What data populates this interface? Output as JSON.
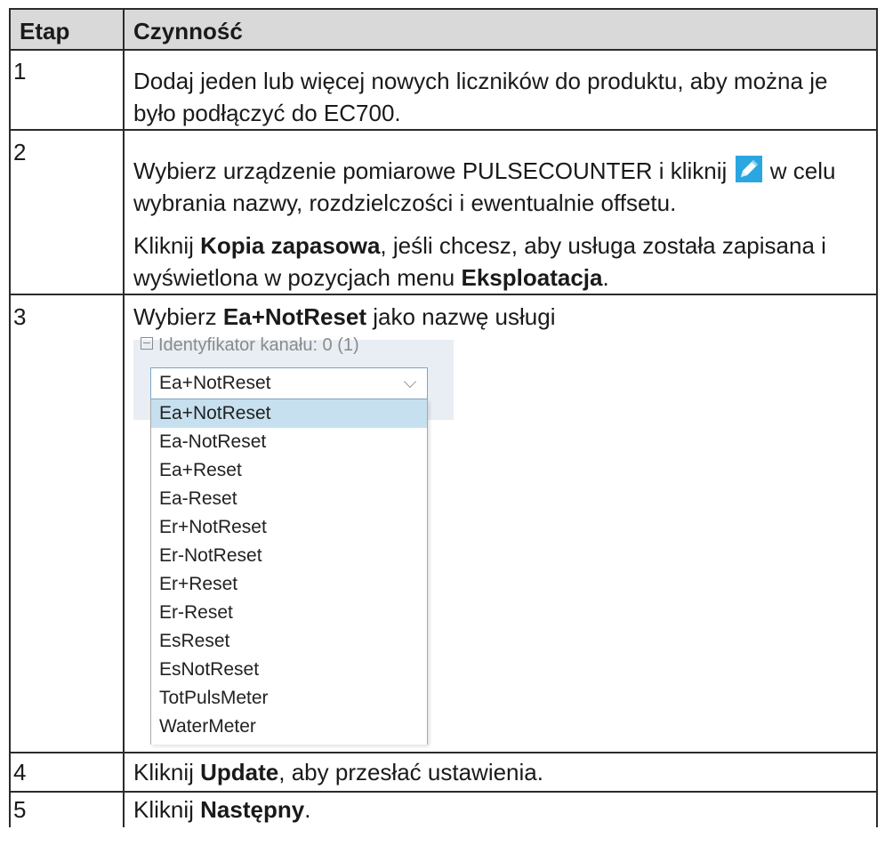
{
  "table": {
    "header": {
      "step": "Etap",
      "action": "Czynność"
    },
    "rows": [
      {
        "step": "1",
        "text": "Dodaj jeden lub więcej nowych liczników do produktu, aby można je było podłączyć do EC700."
      },
      {
        "step": "2",
        "p1_before_icon": "Wybierz urządzenie pomiarowe PULSECOUNTER i kliknij ",
        "p1_after_icon": " w celu wybrania nazwy, rozdzielczości i ewentualnie offsetu.",
        "p2_pre": "Kliknij ",
        "p2_bold1": "Kopia zapasowa",
        "p2_mid": ", jeśli chcesz, aby usługa została zapisana i wyświetlona w pozycjach menu ",
        "p2_bold2": "Eksploatacja",
        "p2_post": "."
      },
      {
        "step": "3",
        "pre": "Wybierz ",
        "bold": "Ea+NotReset",
        "post": " jako nazwę usługi"
      },
      {
        "step": "4",
        "pre": "Kliknij ",
        "bold": "Update",
        "post": ", aby przesłać ustawienia."
      },
      {
        "step": "5",
        "pre": "Kliknij ",
        "bold": "Następny",
        "post": "."
      }
    ]
  },
  "dropdown_screenshot": {
    "channel_label": "Identyfikator kanału: 0 (1)",
    "selected_value": "Ea+NotReset",
    "options": [
      "Ea+NotReset",
      "Ea-NotReset",
      "Ea+Reset",
      "Ea-Reset",
      "Er+NotReset",
      "Er-NotReset",
      "Er+Reset",
      "Er-Reset",
      "EsReset",
      "EsNotReset",
      "TotPulsMeter",
      "WaterMeter"
    ],
    "highlighted_option_index": 0,
    "colors": {
      "panel_bg": "#e8eef3",
      "select_border": "#7fa7c6",
      "highlight": "#c7e0ef"
    }
  },
  "colors": {
    "header_bg": "#d9d9d9",
    "border": "#2b2b2b",
    "pencil_icon_bg": "#2aa6e0"
  }
}
